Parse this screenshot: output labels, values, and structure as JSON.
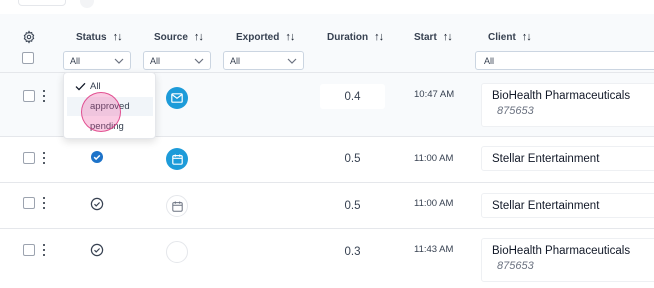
{
  "header": {
    "columns": {
      "status": "Status",
      "source": "Source",
      "exported": "Exported",
      "duration": "Duration",
      "start": "Start",
      "client": "Client"
    },
    "sort_glyph": "↑↓",
    "filters": {
      "status": "All",
      "source": "All",
      "exported": "All",
      "client": "All"
    }
  },
  "status_dropdown": {
    "options": [
      {
        "label": "All",
        "selected": true
      },
      {
        "label": "approved",
        "selected": false
      },
      {
        "label": "pending",
        "selected": false
      }
    ]
  },
  "rows": [
    {
      "status_icon": "none",
      "source_icon": "mail-icon",
      "duration": "0.4",
      "start": "10:47 AM",
      "client": "BioHealth Pharmaceuticals",
      "client_number": "875653"
    },
    {
      "status_icon": "check-circle-filled-icon",
      "source_icon": "calendar-icon",
      "duration": "0.5",
      "start": "11:00 AM",
      "client": "Stellar Entertainment",
      "client_number": ""
    },
    {
      "status_icon": "check-circle-outline-icon",
      "source_icon": "calendar-outline-icon",
      "duration": "0.5",
      "start": "11:00 AM",
      "client": "Stellar Entertainment",
      "client_number": ""
    },
    {
      "status_icon": "check-circle-outline-icon",
      "source_icon": "empty-circle-icon",
      "duration": "0.3",
      "start": "11:43 AM",
      "client": "BioHealth Pharmaceuticals",
      "client_number": "875653"
    }
  ],
  "colors": {
    "accent": "#1d9bd9",
    "status_filled": "#1d73c9",
    "header_bg": "#f8fafc",
    "cursor": "#ec4899"
  }
}
